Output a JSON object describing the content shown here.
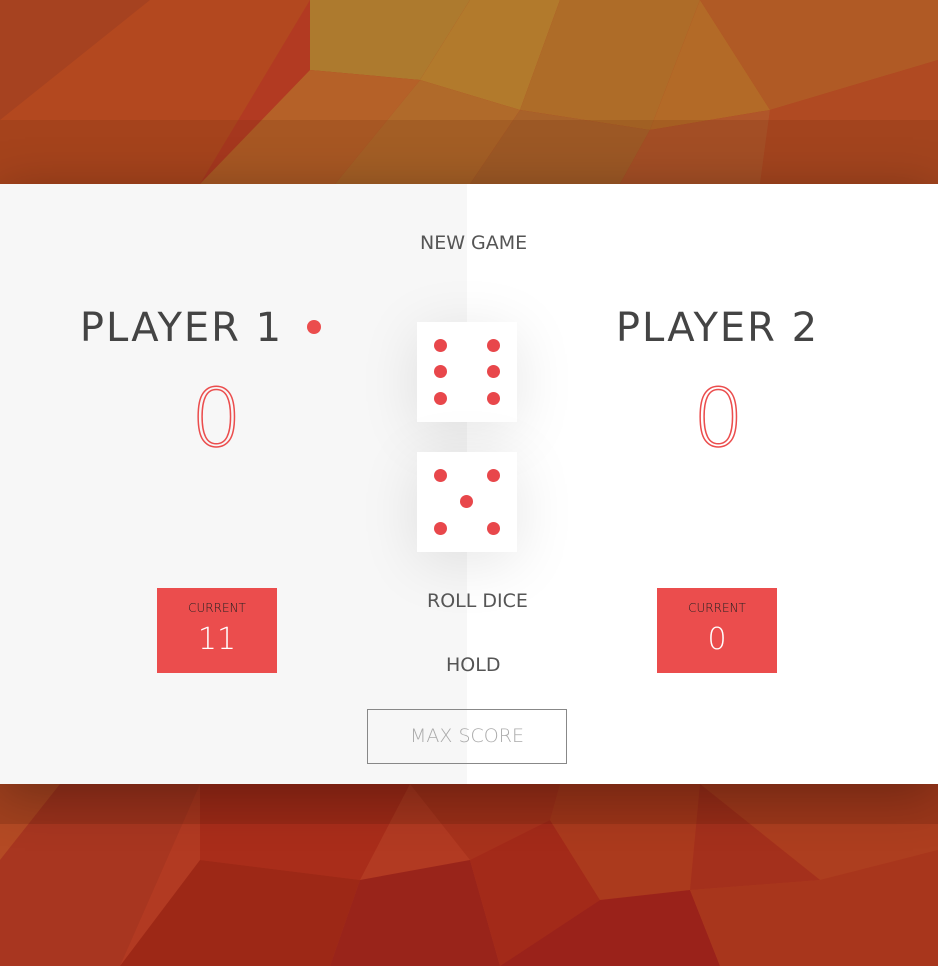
{
  "colors": {
    "accent": "#EB4D4D",
    "panel_left": "#f7f7f7",
    "panel_right": "#ffffff"
  },
  "controls": {
    "new_game": "NEW GAME",
    "roll_dice": "ROLL DICE",
    "hold": "HOLD",
    "max_score_placeholder": "MAX SCORE"
  },
  "players": [
    {
      "name": "PLAYER 1",
      "score": "0",
      "current_label": "CURRENT",
      "current": "11",
      "active": true
    },
    {
      "name": "PLAYER 2",
      "score": "0",
      "current_label": "CURRENT",
      "current": "0",
      "active": false
    }
  ],
  "dice": [
    {
      "value": 6
    },
    {
      "value": 5
    }
  ]
}
